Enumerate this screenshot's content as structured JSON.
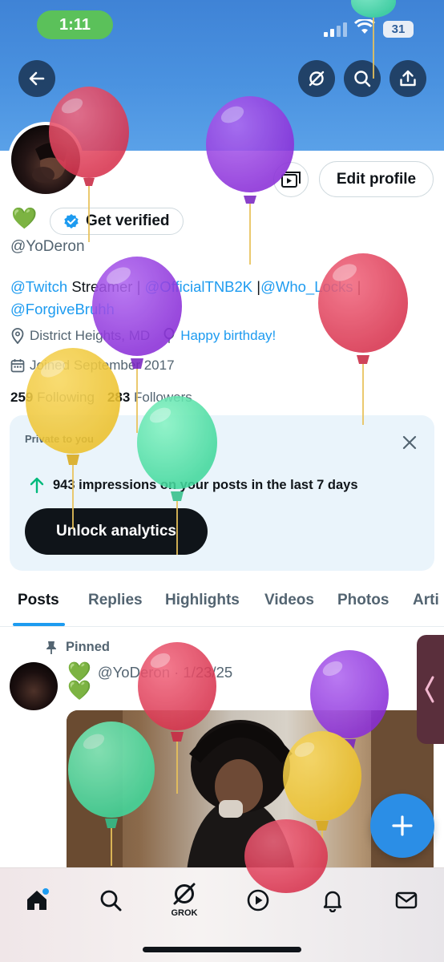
{
  "status_bar": {
    "time": "1:11",
    "battery": "31"
  },
  "profile": {
    "verified_cta": "Get verified",
    "status_emoji": "💚",
    "handle": "@YoDeron",
    "bio": {
      "mention_1": "@Twitch",
      "text_1": " Streamer | ",
      "mention_2": "@OfficialTNB2K",
      "text_2": " |",
      "mention_3": "@Who_Locks",
      "text_3": " |",
      "mention_4": "@ForgiveBruhh"
    },
    "location": "District Heights, MD",
    "birthday": "Happy birthday!",
    "joined": "Joined September 2017",
    "following_count": "259",
    "following_label": "Following",
    "followers_count": "283",
    "followers_label": "Followers",
    "edit_label": "Edit profile"
  },
  "analytics": {
    "private_label": "Private to you",
    "impressions_bold": "943 impressions on your posts in the last 7 days",
    "unlock_label": "Unlock analytics"
  },
  "tabs": [
    "Posts",
    "Replies",
    "Highlights",
    "Videos",
    "Photos",
    "Arti"
  ],
  "post": {
    "pinned_label": "Pinned",
    "emoji": "💚",
    "meta": "@YoDeron · 1/23/25",
    "line2": "💚"
  },
  "nav": {
    "grok_label": "GROK"
  },
  "colors": {
    "accent": "#1d9bf0",
    "banner": "#4a92e0",
    "fab": "#2b8ee6"
  }
}
